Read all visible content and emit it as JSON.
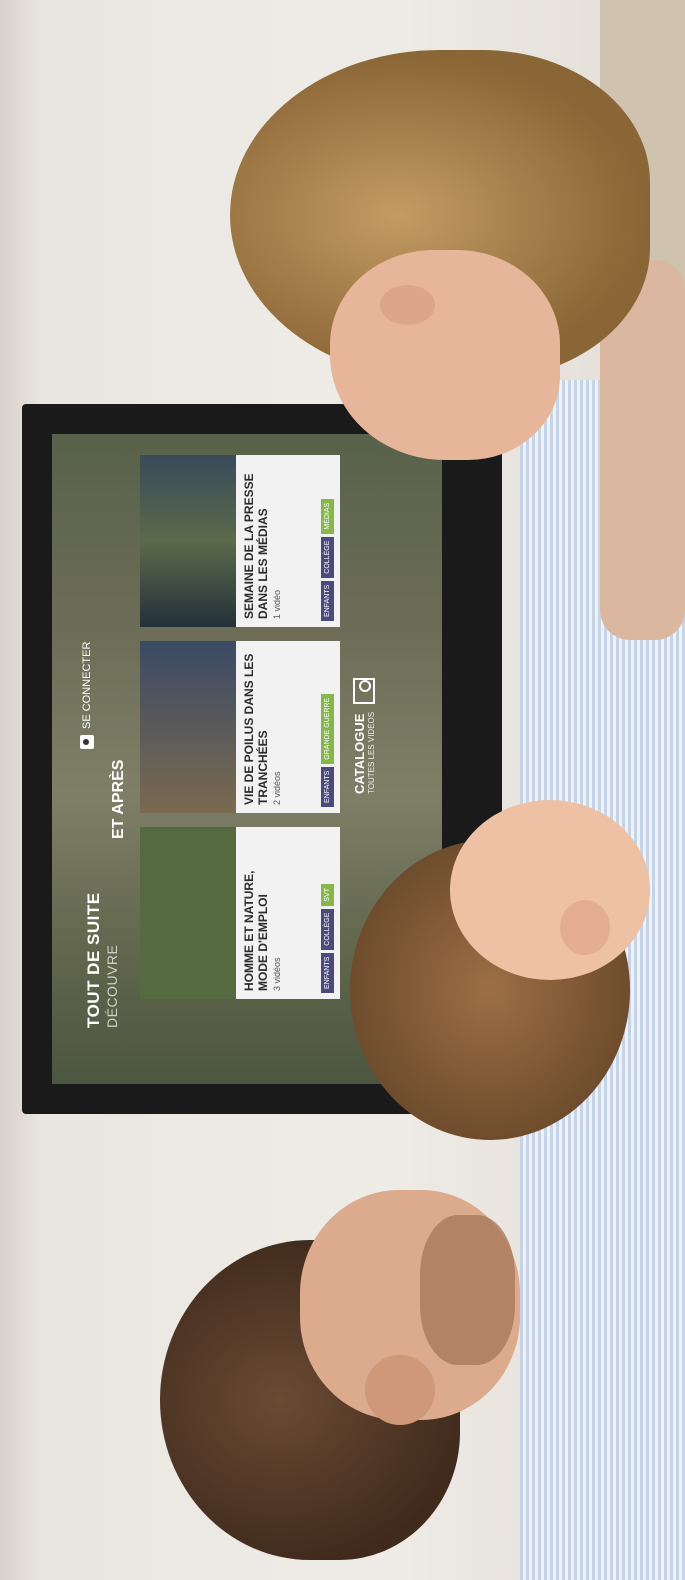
{
  "tv_ui": {
    "section_title": "TOUT DE SUITE",
    "section_subtitle": "DÉCOUVRE",
    "section_title_2": "ET APRÈS",
    "login_label": "SE CONNECTER",
    "cards": [
      {
        "title": "HOMME ET NATURE, MODE D'EMPLOI",
        "count": "3 vidéos",
        "tags": [
          "ENFANTS",
          "COLLÈGE",
          "SVT"
        ]
      },
      {
        "title": "VIE DE POILUS DANS LES TRANCHÉES",
        "count": "2 vidéos",
        "tags": [
          "ENFANTS",
          "GRANDE GUERRE"
        ]
      },
      {
        "title": "SEMAINE DE LA PRESSE DANS LES MÉDIAS",
        "count": "1 vidéo",
        "tags": [
          "ENFANTS",
          "COLLÈGE",
          "MÉDIAS"
        ]
      }
    ],
    "catalogue_label": "CATALOGUE",
    "catalogue_sub": "TOUTES LES VIDÉOS"
  },
  "colors": {
    "tag_purple": "#4b4a7a",
    "tag_green": "#86b74a"
  }
}
